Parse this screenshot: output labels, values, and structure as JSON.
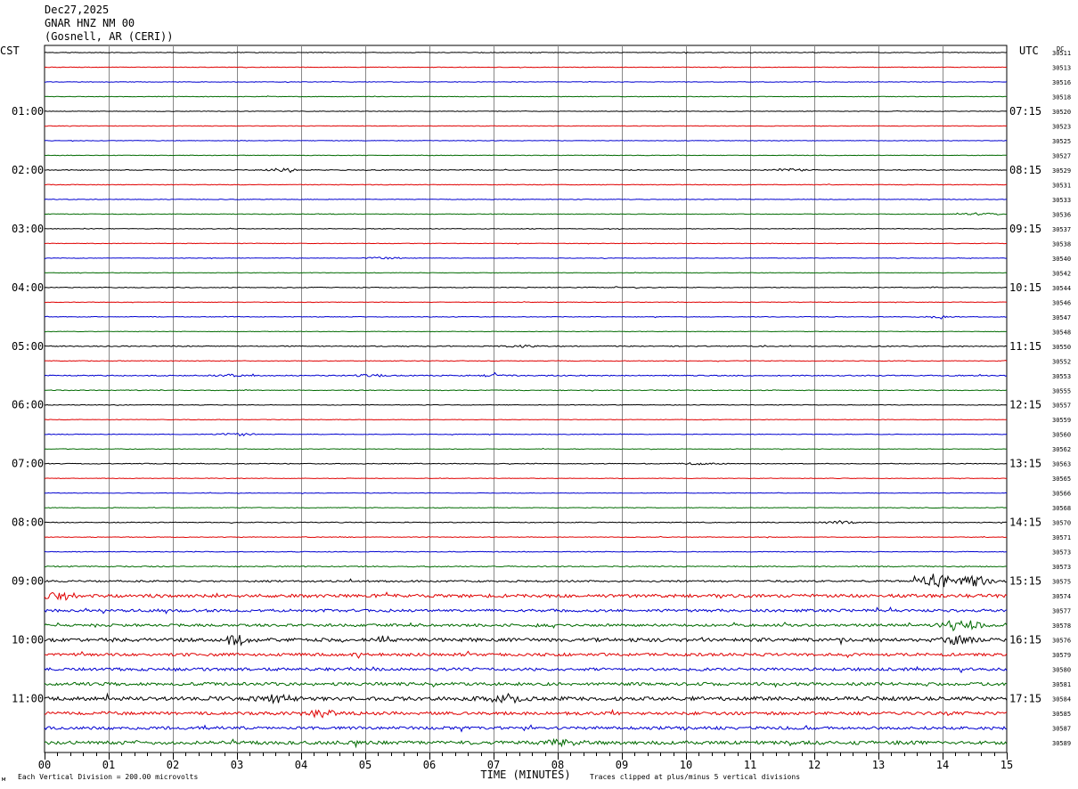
{
  "header": {
    "date": "Dec27,2025",
    "station": "GNAR HNZ NM 00",
    "location": "(Gosnell, AR (CERI))"
  },
  "labels": {
    "left_zone": "CST",
    "right_zone": "UTC",
    "dc_header": "DC"
  },
  "footer": {
    "scale_note": "Each Vertical Division =  200.00 microvolts",
    "clip_note": "Traces clipped at plus/minus 5 vertical divisions",
    "corner_mark": "м"
  },
  "colors": {
    "trace_cycle": [
      "#000000",
      "#e00000",
      "#0000d0",
      "#006a00"
    ],
    "grid": "#888888",
    "axis": "#000000"
  },
  "chart_data": {
    "type": "line",
    "xlabel": "TIME (MINUTES)",
    "xlim": [
      0,
      15
    ],
    "x_ticks": [
      "00",
      "01",
      "02",
      "03",
      "04",
      "05",
      "06",
      "07",
      "08",
      "09",
      "10",
      "11",
      "12",
      "13",
      "14",
      "15"
    ],
    "cst_hour_labels": [
      "01:00",
      "02:00",
      "03:00",
      "04:00",
      "05:00",
      "06:00",
      "07:00",
      "08:00",
      "09:00",
      "10:00",
      "11:00"
    ],
    "utc_hour_labels": [
      "07:15",
      "08:15",
      "09:15",
      "10:15",
      "11:15",
      "12:15",
      "13:15",
      "14:15",
      "15:15",
      "16:15",
      "17:15"
    ],
    "trace_count": 48,
    "dc_offsets": [
      30511,
      30513,
      30516,
      30518,
      30520,
      30523,
      30525,
      30527,
      30529,
      30531,
      30533,
      30536,
      30537,
      30538,
      30540,
      30542,
      30544,
      30546,
      30547,
      30548,
      30550,
      30552,
      30553,
      30555,
      30557,
      30559,
      30560,
      30562,
      30563,
      30565,
      30566,
      30568,
      30570,
      30571,
      30573,
      30573,
      30575,
      30574,
      30577,
      30578,
      30576,
      30579,
      30580,
      30581,
      30584,
      30585,
      30587,
      30589
    ],
    "noise_level": [
      0.4,
      0.3,
      0.3,
      0.3,
      0.3,
      0.3,
      0.3,
      0.3,
      0.45,
      0.35,
      0.35,
      0.35,
      0.35,
      0.3,
      0.3,
      0.3,
      0.4,
      0.3,
      0.35,
      0.3,
      0.5,
      0.35,
      0.55,
      0.4,
      0.35,
      0.3,
      0.35,
      0.3,
      0.4,
      0.3,
      0.3,
      0.35,
      0.45,
      0.35,
      0.4,
      0.6,
      1.0,
      1.8,
      1.5,
      1.4,
      1.9,
      1.6,
      1.6,
      1.7,
      2.1,
      1.7,
      1.6,
      1.9
    ],
    "events": [
      {
        "trace": 8,
        "minute": 3.7,
        "amplitude": 1.5
      },
      {
        "trace": 8,
        "minute": 11.6,
        "amplitude": 1.4
      },
      {
        "trace": 11,
        "minute": 14.6,
        "amplitude": 1.3
      },
      {
        "trace": 14,
        "minute": 5.3,
        "amplitude": 1.2
      },
      {
        "trace": 18,
        "minute": 13.9,
        "amplitude": 1.0
      },
      {
        "trace": 20,
        "minute": 7.4,
        "amplitude": 1.1
      },
      {
        "trace": 22,
        "minute": 2.9,
        "amplitude": 1.1
      },
      {
        "trace": 22,
        "minute": 5.1,
        "amplitude": 1.2
      },
      {
        "trace": 22,
        "minute": 7.0,
        "amplitude": 1.0
      },
      {
        "trace": 26,
        "minute": 3.0,
        "amplitude": 1.4
      },
      {
        "trace": 28,
        "minute": 10.2,
        "amplitude": 1.1
      },
      {
        "trace": 32,
        "minute": 12.4,
        "amplitude": 1.5
      },
      {
        "trace": 36,
        "minute": 13.9,
        "amplitude": 8.0
      },
      {
        "trace": 36,
        "minute": 14.5,
        "amplitude": 5.0
      },
      {
        "trace": 37,
        "minute": 0.2,
        "amplitude": 4.0
      },
      {
        "trace": 39,
        "minute": 14.3,
        "amplitude": 6.5
      },
      {
        "trace": 40,
        "minute": 3.0,
        "amplitude": 5.0
      },
      {
        "trace": 40,
        "minute": 14.2,
        "amplitude": 3.5
      },
      {
        "trace": 44,
        "minute": 3.6,
        "amplitude": 3.0
      },
      {
        "trace": 44,
        "minute": 7.2,
        "amplitude": 3.5
      },
      {
        "trace": 45,
        "minute": 4.3,
        "amplitude": 3.0
      },
      {
        "trace": 47,
        "minute": 8.1,
        "amplitude": 3.0
      }
    ]
  }
}
